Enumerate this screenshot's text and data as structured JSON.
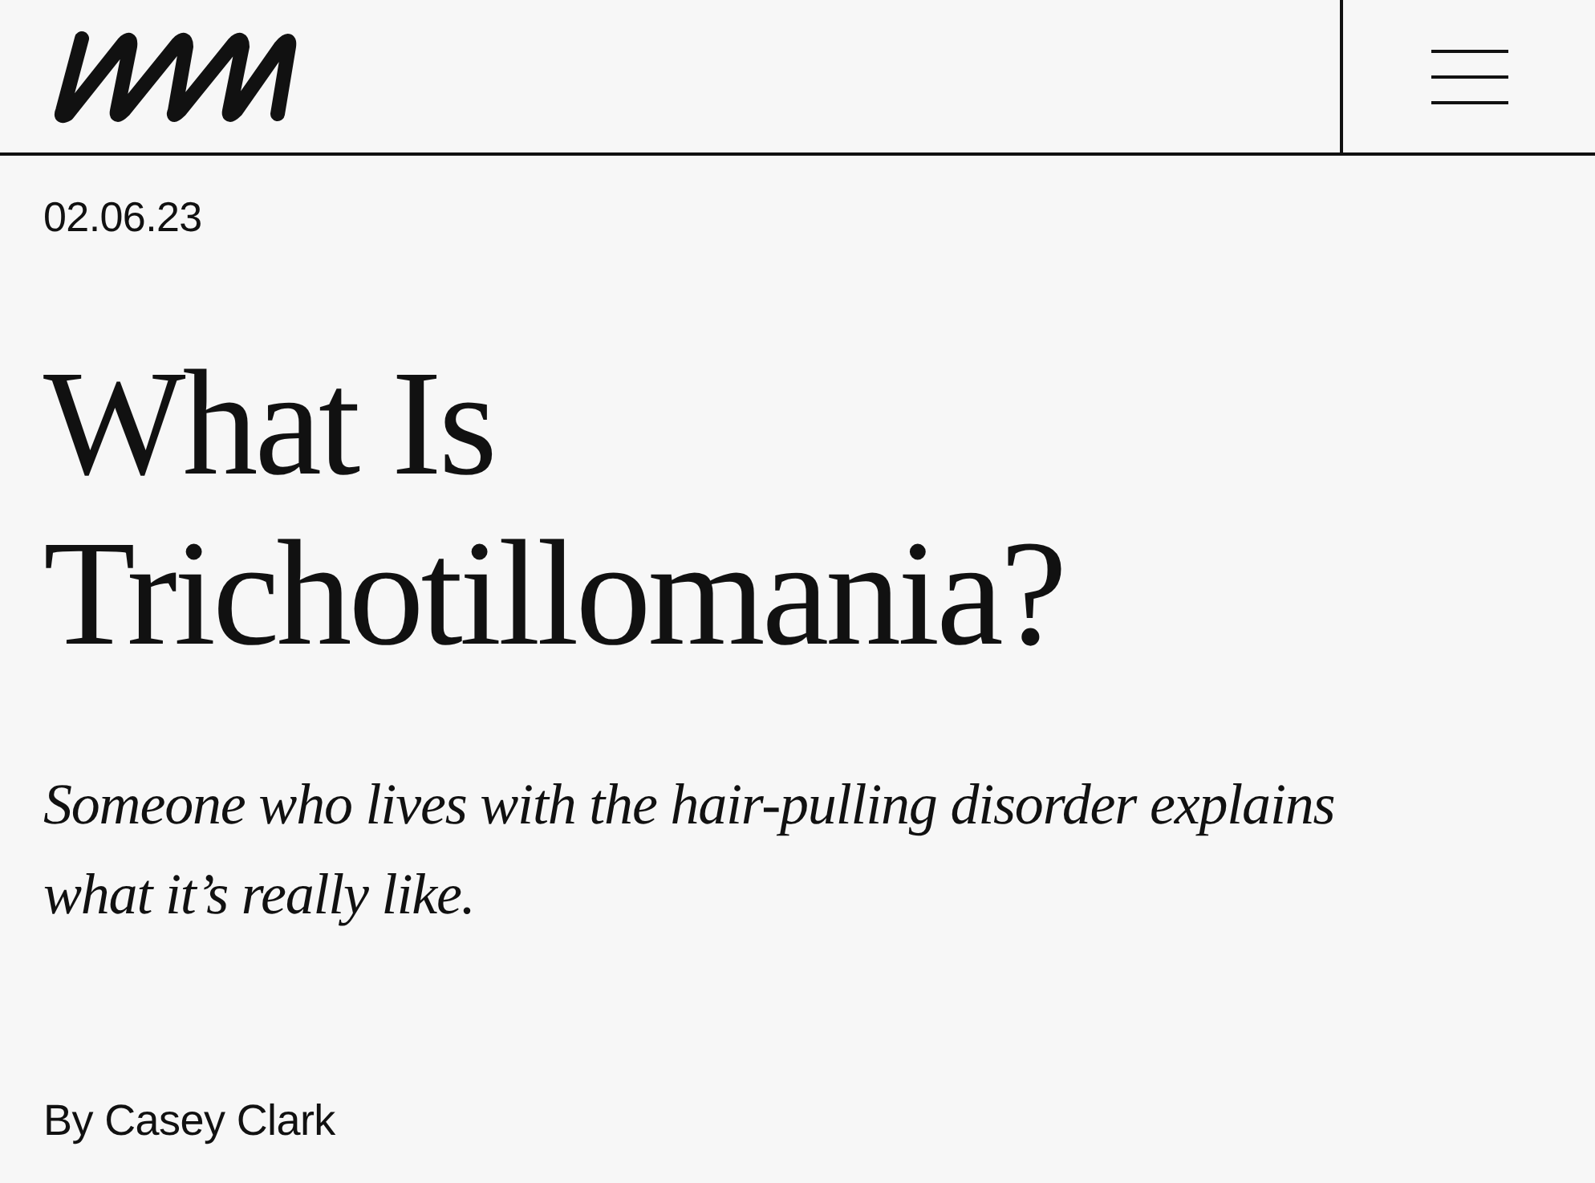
{
  "article": {
    "date": "02.06.23",
    "title": "What Is Trichotillomania?",
    "subtitle": "Someone who lives with the hair-pulling disorder explains what it’s really like.",
    "byline": "By Casey Clark"
  }
}
